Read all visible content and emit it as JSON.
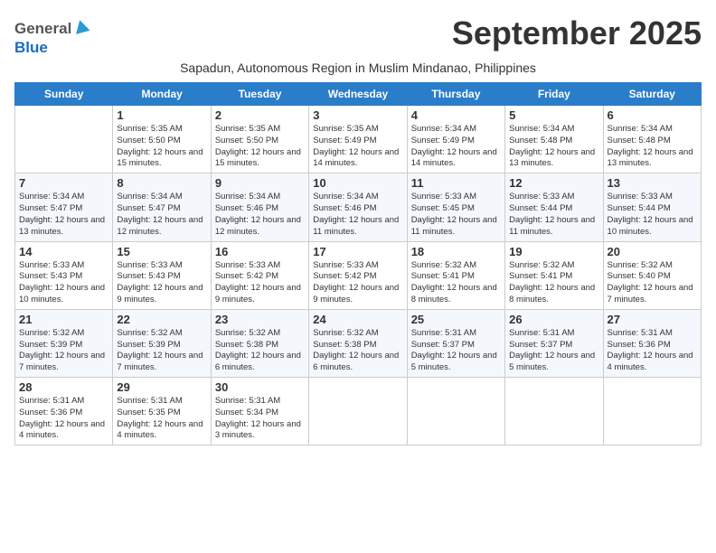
{
  "logo": {
    "general": "General",
    "blue": "Blue"
  },
  "title": "September 2025",
  "subtitle": "Sapadun, Autonomous Region in Muslim Mindanao, Philippines",
  "days_of_week": [
    "Sunday",
    "Monday",
    "Tuesday",
    "Wednesday",
    "Thursday",
    "Friday",
    "Saturday"
  ],
  "weeks": [
    [
      {
        "day": "",
        "sunrise": "",
        "sunset": "",
        "daylight": ""
      },
      {
        "day": "1",
        "sunrise": "Sunrise: 5:35 AM",
        "sunset": "Sunset: 5:50 PM",
        "daylight": "Daylight: 12 hours and 15 minutes."
      },
      {
        "day": "2",
        "sunrise": "Sunrise: 5:35 AM",
        "sunset": "Sunset: 5:50 PM",
        "daylight": "Daylight: 12 hours and 15 minutes."
      },
      {
        "day": "3",
        "sunrise": "Sunrise: 5:35 AM",
        "sunset": "Sunset: 5:49 PM",
        "daylight": "Daylight: 12 hours and 14 minutes."
      },
      {
        "day": "4",
        "sunrise": "Sunrise: 5:34 AM",
        "sunset": "Sunset: 5:49 PM",
        "daylight": "Daylight: 12 hours and 14 minutes."
      },
      {
        "day": "5",
        "sunrise": "Sunrise: 5:34 AM",
        "sunset": "Sunset: 5:48 PM",
        "daylight": "Daylight: 12 hours and 13 minutes."
      },
      {
        "day": "6",
        "sunrise": "Sunrise: 5:34 AM",
        "sunset": "Sunset: 5:48 PM",
        "daylight": "Daylight: 12 hours and 13 minutes."
      }
    ],
    [
      {
        "day": "7",
        "sunrise": "Sunrise: 5:34 AM",
        "sunset": "Sunset: 5:47 PM",
        "daylight": "Daylight: 12 hours and 13 minutes."
      },
      {
        "day": "8",
        "sunrise": "Sunrise: 5:34 AM",
        "sunset": "Sunset: 5:47 PM",
        "daylight": "Daylight: 12 hours and 12 minutes."
      },
      {
        "day": "9",
        "sunrise": "Sunrise: 5:34 AM",
        "sunset": "Sunset: 5:46 PM",
        "daylight": "Daylight: 12 hours and 12 minutes."
      },
      {
        "day": "10",
        "sunrise": "Sunrise: 5:34 AM",
        "sunset": "Sunset: 5:46 PM",
        "daylight": "Daylight: 12 hours and 11 minutes."
      },
      {
        "day": "11",
        "sunrise": "Sunrise: 5:33 AM",
        "sunset": "Sunset: 5:45 PM",
        "daylight": "Daylight: 12 hours and 11 minutes."
      },
      {
        "day": "12",
        "sunrise": "Sunrise: 5:33 AM",
        "sunset": "Sunset: 5:44 PM",
        "daylight": "Daylight: 12 hours and 11 minutes."
      },
      {
        "day": "13",
        "sunrise": "Sunrise: 5:33 AM",
        "sunset": "Sunset: 5:44 PM",
        "daylight": "Daylight: 12 hours and 10 minutes."
      }
    ],
    [
      {
        "day": "14",
        "sunrise": "Sunrise: 5:33 AM",
        "sunset": "Sunset: 5:43 PM",
        "daylight": "Daylight: 12 hours and 10 minutes."
      },
      {
        "day": "15",
        "sunrise": "Sunrise: 5:33 AM",
        "sunset": "Sunset: 5:43 PM",
        "daylight": "Daylight: 12 hours and 9 minutes."
      },
      {
        "day": "16",
        "sunrise": "Sunrise: 5:33 AM",
        "sunset": "Sunset: 5:42 PM",
        "daylight": "Daylight: 12 hours and 9 minutes."
      },
      {
        "day": "17",
        "sunrise": "Sunrise: 5:33 AM",
        "sunset": "Sunset: 5:42 PM",
        "daylight": "Daylight: 12 hours and 9 minutes."
      },
      {
        "day": "18",
        "sunrise": "Sunrise: 5:32 AM",
        "sunset": "Sunset: 5:41 PM",
        "daylight": "Daylight: 12 hours and 8 minutes."
      },
      {
        "day": "19",
        "sunrise": "Sunrise: 5:32 AM",
        "sunset": "Sunset: 5:41 PM",
        "daylight": "Daylight: 12 hours and 8 minutes."
      },
      {
        "day": "20",
        "sunrise": "Sunrise: 5:32 AM",
        "sunset": "Sunset: 5:40 PM",
        "daylight": "Daylight: 12 hours and 7 minutes."
      }
    ],
    [
      {
        "day": "21",
        "sunrise": "Sunrise: 5:32 AM",
        "sunset": "Sunset: 5:39 PM",
        "daylight": "Daylight: 12 hours and 7 minutes."
      },
      {
        "day": "22",
        "sunrise": "Sunrise: 5:32 AM",
        "sunset": "Sunset: 5:39 PM",
        "daylight": "Daylight: 12 hours and 7 minutes."
      },
      {
        "day": "23",
        "sunrise": "Sunrise: 5:32 AM",
        "sunset": "Sunset: 5:38 PM",
        "daylight": "Daylight: 12 hours and 6 minutes."
      },
      {
        "day": "24",
        "sunrise": "Sunrise: 5:32 AM",
        "sunset": "Sunset: 5:38 PM",
        "daylight": "Daylight: 12 hours and 6 minutes."
      },
      {
        "day": "25",
        "sunrise": "Sunrise: 5:31 AM",
        "sunset": "Sunset: 5:37 PM",
        "daylight": "Daylight: 12 hours and 5 minutes."
      },
      {
        "day": "26",
        "sunrise": "Sunrise: 5:31 AM",
        "sunset": "Sunset: 5:37 PM",
        "daylight": "Daylight: 12 hours and 5 minutes."
      },
      {
        "day": "27",
        "sunrise": "Sunrise: 5:31 AM",
        "sunset": "Sunset: 5:36 PM",
        "daylight": "Daylight: 12 hours and 4 minutes."
      }
    ],
    [
      {
        "day": "28",
        "sunrise": "Sunrise: 5:31 AM",
        "sunset": "Sunset: 5:36 PM",
        "daylight": "Daylight: 12 hours and 4 minutes."
      },
      {
        "day": "29",
        "sunrise": "Sunrise: 5:31 AM",
        "sunset": "Sunset: 5:35 PM",
        "daylight": "Daylight: 12 hours and 4 minutes."
      },
      {
        "day": "30",
        "sunrise": "Sunrise: 5:31 AM",
        "sunset": "Sunset: 5:34 PM",
        "daylight": "Daylight: 12 hours and 3 minutes."
      },
      {
        "day": "",
        "sunrise": "",
        "sunset": "",
        "daylight": ""
      },
      {
        "day": "",
        "sunrise": "",
        "sunset": "",
        "daylight": ""
      },
      {
        "day": "",
        "sunrise": "",
        "sunset": "",
        "daylight": ""
      },
      {
        "day": "",
        "sunrise": "",
        "sunset": "",
        "daylight": ""
      }
    ]
  ]
}
